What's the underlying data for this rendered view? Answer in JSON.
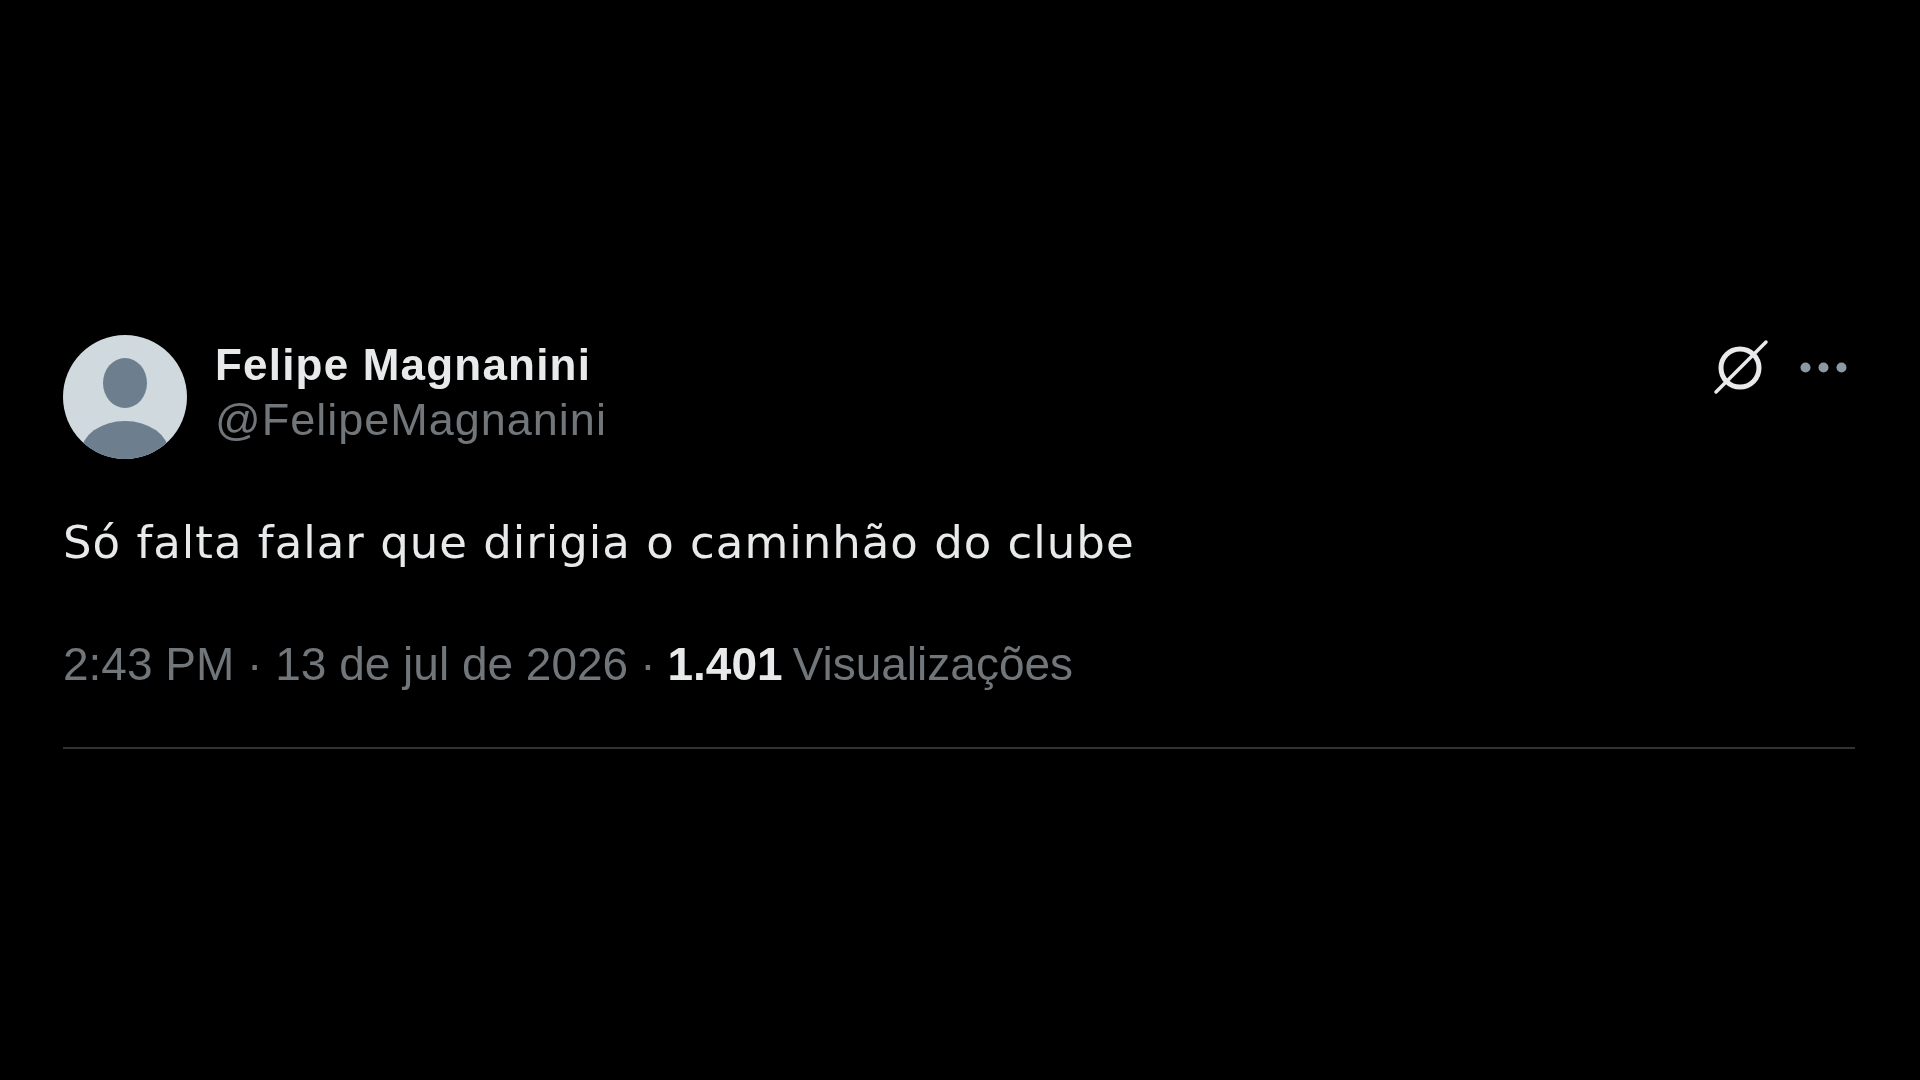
{
  "tweet": {
    "author": {
      "name": "Felipe Magnanini",
      "handle": "@FelipeMagnanini"
    },
    "text": "Só falta falar que dirigia o caminhão do clube",
    "timestamp": "2:43 PM · 13 de jul de 2026",
    "separator": "·",
    "views": {
      "count": "1.401",
      "label": "Visualizações"
    }
  }
}
